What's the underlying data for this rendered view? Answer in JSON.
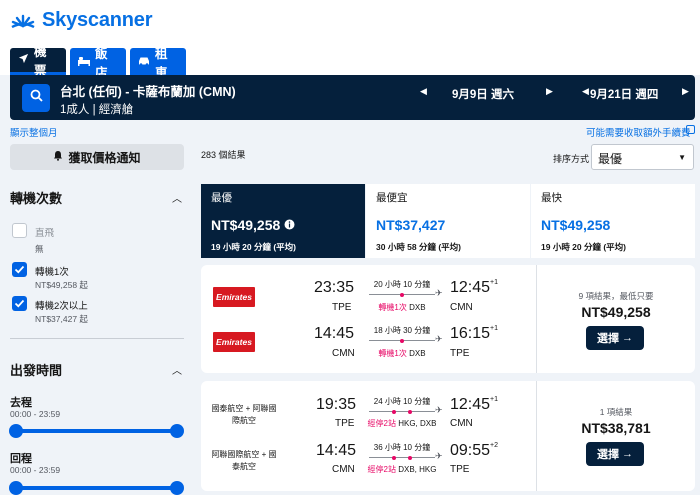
{
  "header": {
    "brand": "Skyscanner",
    "tabs": [
      {
        "label": "機票",
        "icon": "plane-icon"
      },
      {
        "label": "飯店",
        "icon": "bed-icon"
      },
      {
        "label": "租車",
        "icon": "car-icon"
      }
    ]
  },
  "search": {
    "route": "台北 (任何) - 卡薩布蘭加 (CMN)",
    "passengers": "1成人 | 經濟艙",
    "depart_date": "9月9日 週六",
    "return_date": "9月21日 週四"
  },
  "links": {
    "whole_month": "顯示整個月",
    "fees": "可能需要收取額外手續費"
  },
  "filters": {
    "price_alert": "獲取價格通知",
    "stops_title": "轉機次數",
    "stops": [
      {
        "label": "直飛",
        "sub": "無",
        "checked": false
      },
      {
        "label": "轉機1次",
        "sub": "NT$49,258 起",
        "checked": true
      },
      {
        "label": "轉機2次以上",
        "sub": "NT$37,427 起",
        "checked": true
      }
    ],
    "departure_title": "出發時間",
    "outbound_label": "去程",
    "outbound_range": "00:00 - 23:59",
    "return_label": "回程",
    "return_range": "00:00 - 23:59"
  },
  "results": {
    "count": "283 個結果",
    "sort_label": "排序方式",
    "sort_value": "最優"
  },
  "sort_tabs": [
    {
      "name": "最優",
      "price": "NT$49,258",
      "duration": "19 小時 20 分鐘 (平均)"
    },
    {
      "name": "最便宜",
      "price": "NT$37,427",
      "duration": "30 小時 58 分鐘 (平均)"
    },
    {
      "name": "最快",
      "price": "NT$49,258",
      "duration": "19 小時 20 分鐘 (平均)"
    }
  ],
  "cards": [
    {
      "legs": [
        {
          "airline": "Emirates",
          "dep_time": "23:35",
          "dep_code": "TPE",
          "duration": "20 小時 10 分鐘",
          "stops_red": "轉機1次",
          "stops_via": "DXB",
          "arr_time": "12:45",
          "arr_sup": "+1",
          "arr_code": "CMN"
        },
        {
          "airline": "Emirates",
          "dep_time": "14:45",
          "dep_code": "CMN",
          "duration": "18 小時 30 分鐘",
          "stops_red": "轉機1次",
          "stops_via": "DXB",
          "arr_time": "16:15",
          "arr_sup": "+1",
          "arr_code": "TPE"
        }
      ],
      "deal": "9 項結果，最低只要",
      "price": "NT$49,258",
      "button": "選擇"
    },
    {
      "legs": [
        {
          "airline": "國泰航空 + 阿聯國際航空",
          "dep_time": "19:35",
          "dep_code": "TPE",
          "duration": "24 小時 10 分鐘",
          "stops_red": "經停2站",
          "stops_via": "HKG, DXB",
          "arr_time": "12:45",
          "arr_sup": "+1",
          "arr_code": "CMN"
        },
        {
          "airline": "阿聯國際航空 + 國泰航空",
          "dep_time": "14:45",
          "dep_code": "CMN",
          "duration": "36 小時 10 分鐘",
          "stops_red": "經停2站",
          "stops_via": "DXB, HKG",
          "arr_time": "09:55",
          "arr_sup": "+2",
          "arr_code": "TPE"
        }
      ],
      "deal": "1 項結果",
      "price": "NT$38,781",
      "button": "選擇"
    }
  ]
}
